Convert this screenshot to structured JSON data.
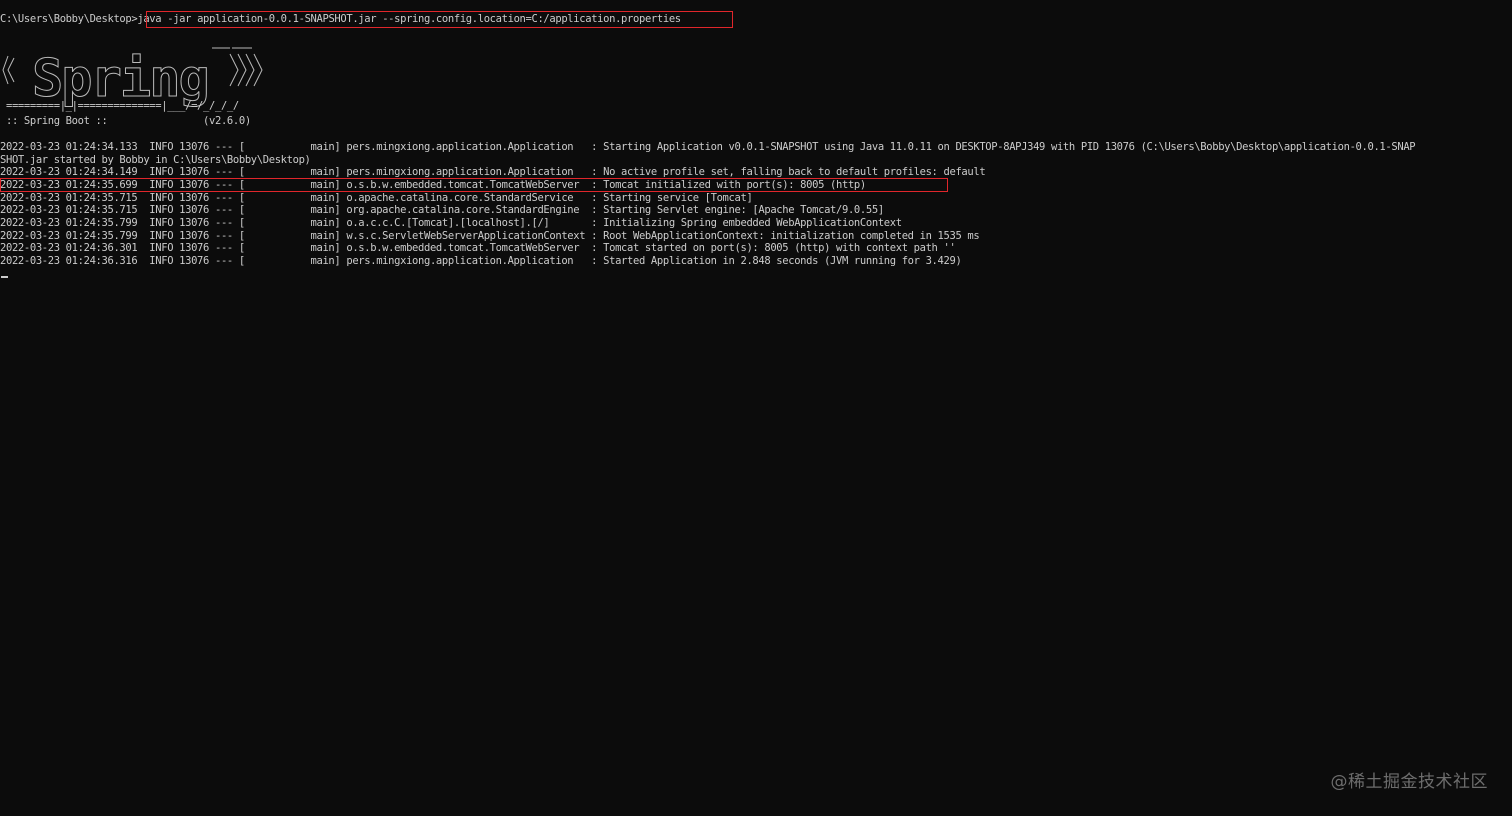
{
  "prompt": {
    "path": "C:\\Users\\Bobby\\Desktop>",
    "command": "java -jar application-0.0.1-SNAPSHOT.jar --spring.config.location=C:/application.properties"
  },
  "banner": {
    "logo_text": "Spring",
    "separator_line": " =========|_|==============|___/=/_/_/_/",
    "boot_line": " :: Spring Boot ::                (v2.6.0)"
  },
  "log_lines": [
    "2022-03-23 01:24:34.133  INFO 13076 --- [           main] pers.mingxiong.application.Application   : Starting Application v0.0.1-SNAPSHOT using Java 11.0.11 on DESKTOP-8APJ349 with PID 13076 (C:\\Users\\Bobby\\Desktop\\application-0.0.1-SNAP",
    "SHOT.jar started by Bobby in C:\\Users\\Bobby\\Desktop)",
    "2022-03-23 01:24:34.149  INFO 13076 --- [           main] pers.mingxiong.application.Application   : No active profile set, falling back to default profiles: default",
    "2022-03-23 01:24:35.699  INFO 13076 --- [           main] o.s.b.w.embedded.tomcat.TomcatWebServer  : Tomcat initialized with port(s): 8005 (http)",
    "2022-03-23 01:24:35.715  INFO 13076 --- [           main] o.apache.catalina.core.StandardService   : Starting service [Tomcat]",
    "2022-03-23 01:24:35.715  INFO 13076 --- [           main] org.apache.catalina.core.StandardEngine  : Starting Servlet engine: [Apache Tomcat/9.0.55]",
    "2022-03-23 01:24:35.799  INFO 13076 --- [           main] o.a.c.c.C.[Tomcat].[localhost].[/]       : Initializing Spring embedded WebApplicationContext",
    "2022-03-23 01:24:35.799  INFO 13076 --- [           main] w.s.c.ServletWebServerApplicationContext : Root WebApplicationContext: initialization completed in 1535 ms",
    "2022-03-23 01:24:36.301  INFO 13076 --- [           main] o.s.b.w.embedded.tomcat.TomcatWebServer  : Tomcat started on port(s): 8005 (http) with context path ''",
    "2022-03-23 01:24:36.316  INFO 13076 --- [           main] pers.mingxiong.application.Application   : Started Application in 2.848 seconds (JVM running for 3.429)"
  ],
  "watermark": "@稀土掘金技术社区",
  "colors": {
    "background": "#0c0c0c",
    "text": "#cccccc",
    "highlight": "#e0262b"
  }
}
